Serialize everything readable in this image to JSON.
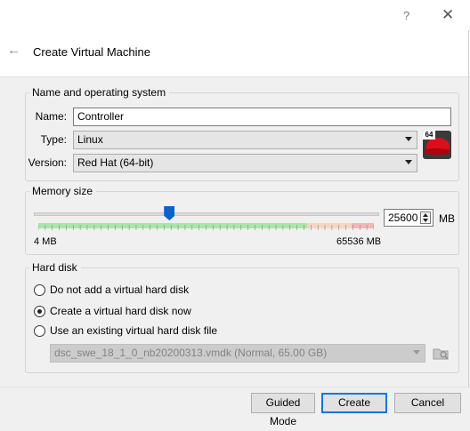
{
  "window": {
    "help_glyph": "?",
    "close_glyph": "✕"
  },
  "header": {
    "back_glyph": "←",
    "title": "Create Virtual Machine"
  },
  "name_os": {
    "legend": "Name and operating system",
    "name_label": "Name:",
    "name_value": "Controller",
    "type_label": "Type:",
    "type_value": "Linux",
    "version_label": "Version:",
    "version_value": "Red Hat (64-bit)",
    "os_icon_badge": "64",
    "os_icon": "redhat-os-icon"
  },
  "memory": {
    "legend": "Memory size",
    "min_label": "4 MB",
    "max_label": "65536 MB",
    "value": "25600",
    "unit": "MB",
    "min_mb": 4,
    "max_mb": 65536,
    "current_mb": 25600,
    "scale_colors": {
      "ok": "#78d878",
      "warn": "#f0c8a0",
      "danger": "#f0a0a0"
    }
  },
  "hard_disk": {
    "legend": "Hard disk",
    "options": [
      {
        "label": "Do not add a virtual hard disk",
        "checked": false
      },
      {
        "label": "Create a virtual hard disk now",
        "checked": true
      },
      {
        "label": "Use an existing virtual hard disk file",
        "checked": false
      }
    ],
    "existing_file_value": "dsc_swe_18_1_0_nb20200313.vmdk (Normal, 65.00 GB)",
    "folder_icon": "folder-browse-icon"
  },
  "buttons": {
    "guided_mode": "Guided Mode",
    "create": "Create",
    "cancel": "Cancel"
  },
  "colors": {
    "accent": "#0078d7",
    "slider_thumb": "#0a64c8"
  }
}
